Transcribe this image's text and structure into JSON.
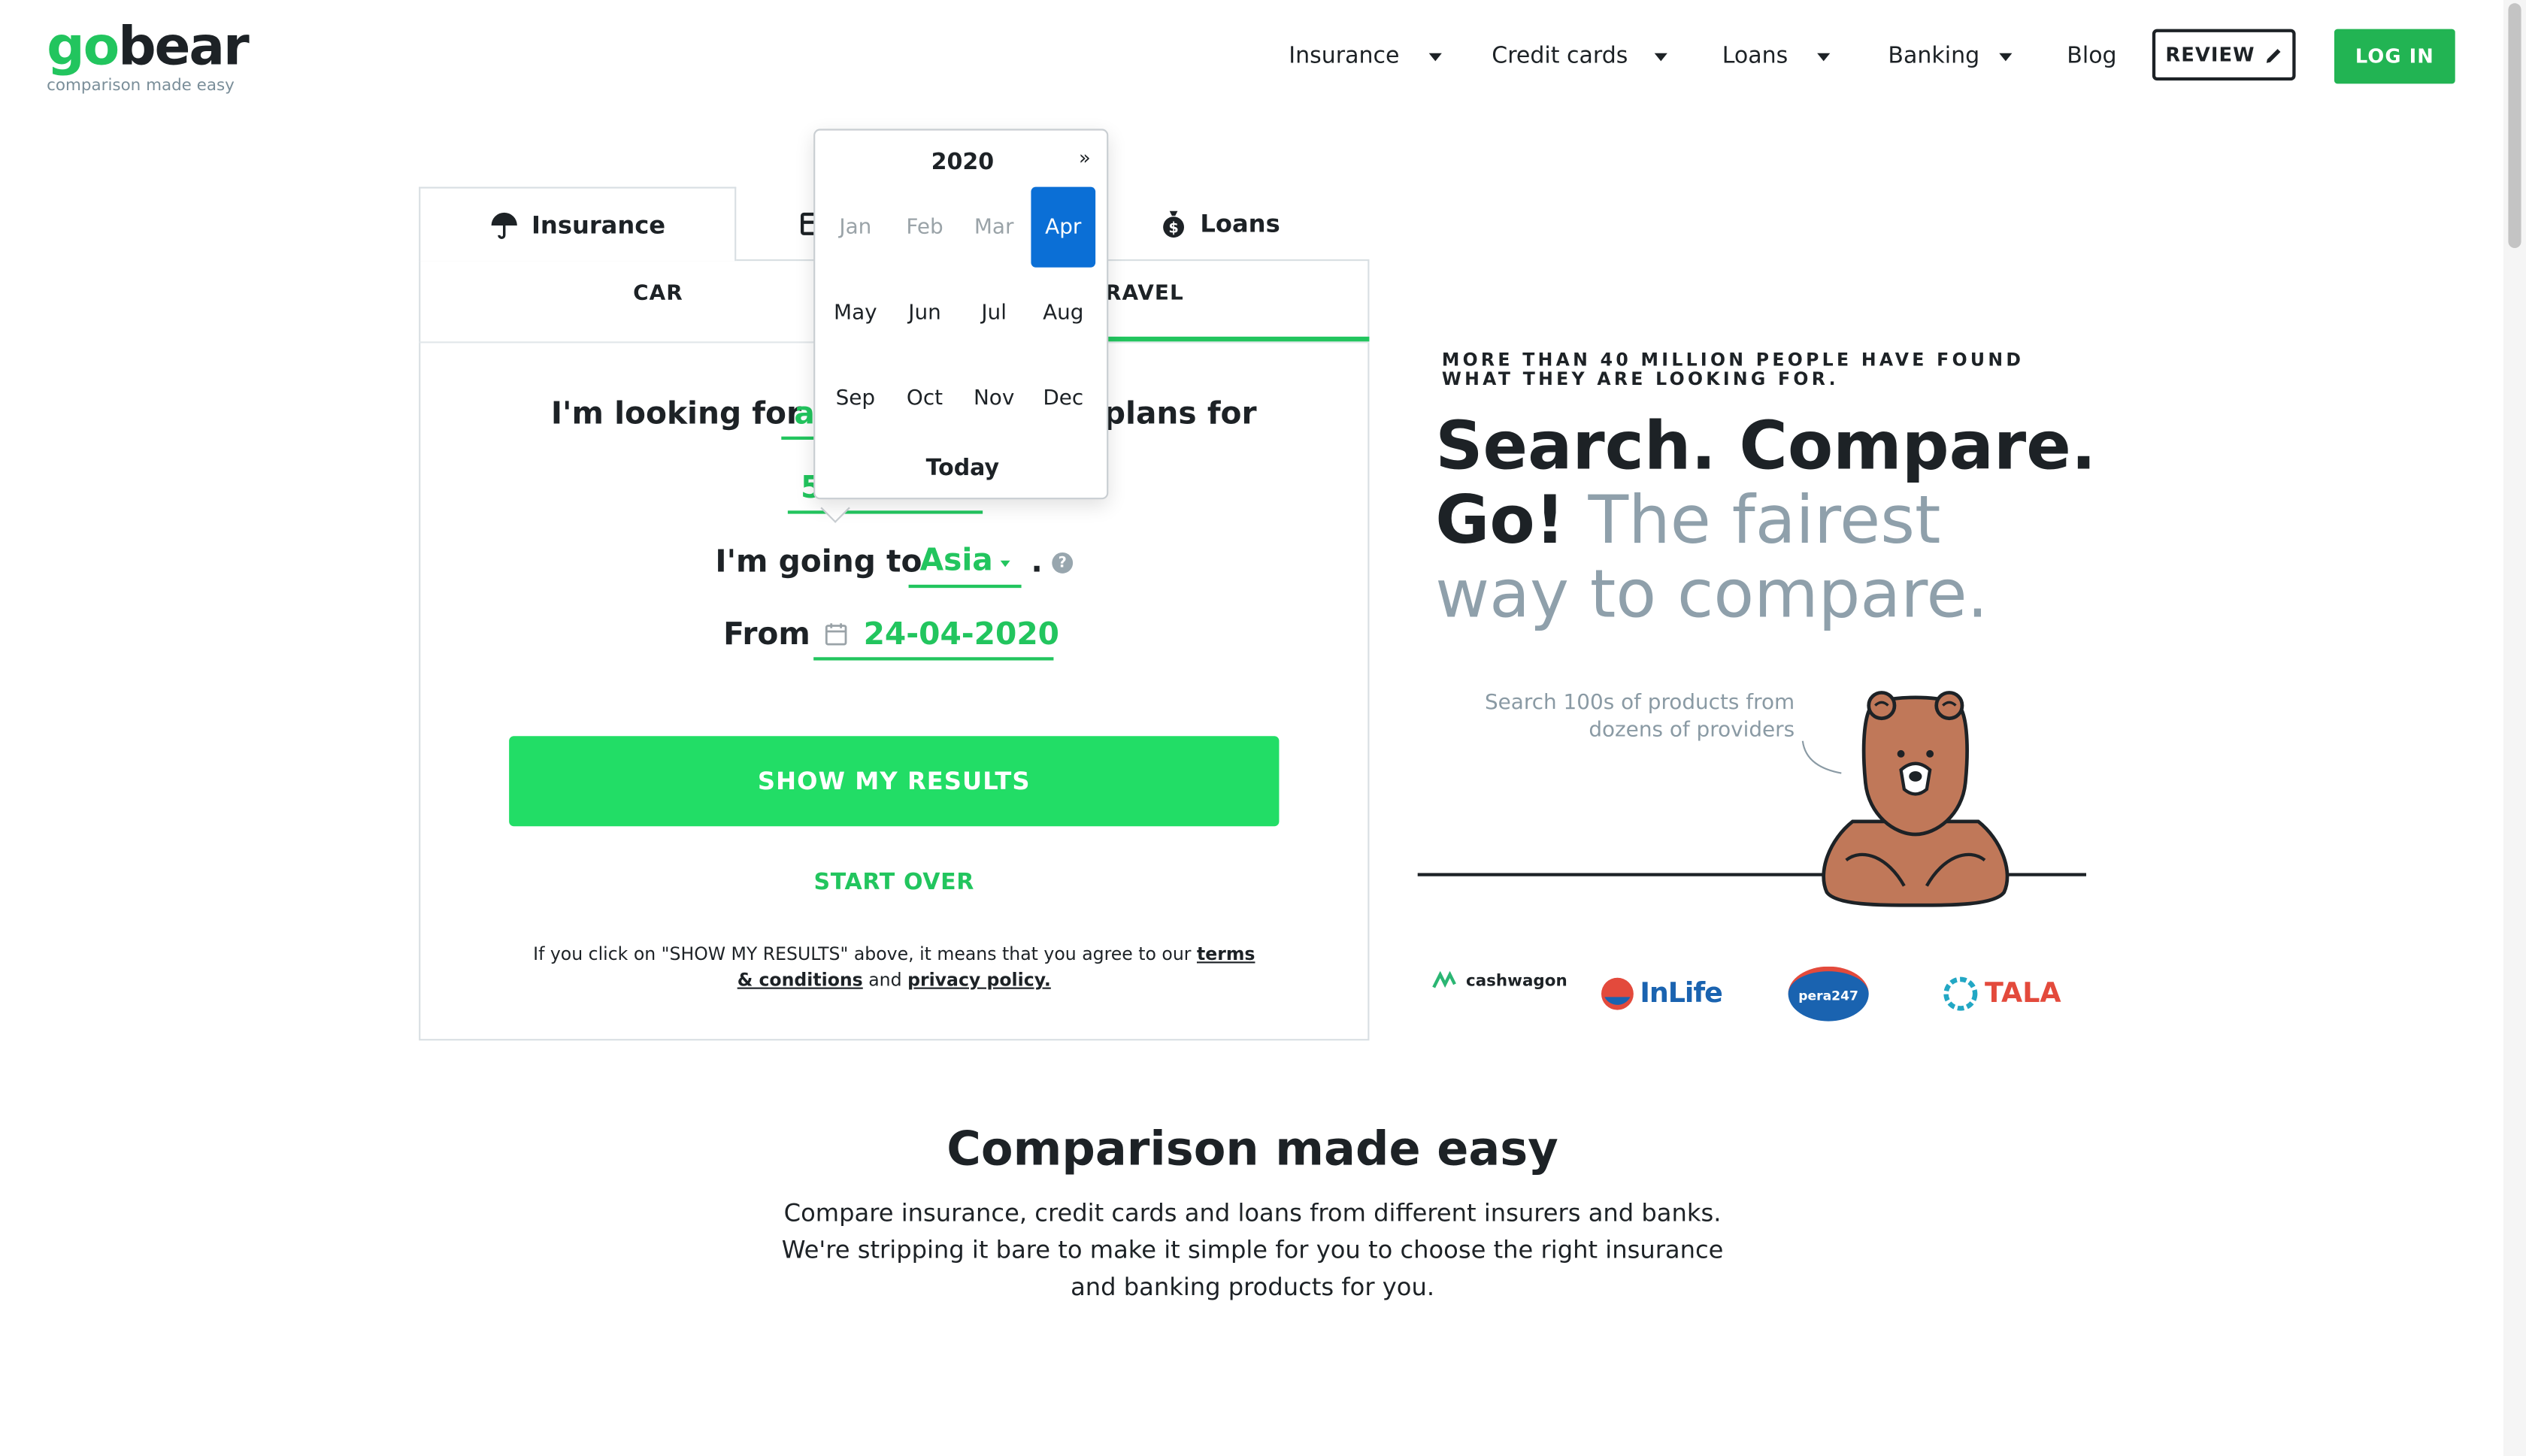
{
  "brand": {
    "logo_prefix": "go",
    "logo_suffix": "bear",
    "tagline": "comparison made easy"
  },
  "nav": {
    "items": [
      {
        "label": "Insurance"
      },
      {
        "label": "Credit cards"
      },
      {
        "label": "Loans"
      },
      {
        "label": "Banking"
      },
      {
        "label": "Blog"
      }
    ],
    "review_label": "REVIEW",
    "login_label": "LOG IN"
  },
  "widget": {
    "tabs": [
      {
        "label": "Insurance"
      },
      {
        "label": ""
      },
      {
        "label": "Loans"
      }
    ],
    "subtabs": [
      {
        "label": "CAR"
      },
      {
        "label": "RAVEL"
      }
    ],
    "q1_prefix": "I'm looking for",
    "q1_value": "a",
    "q1_suffix": "plans for",
    "q1b_value": "5",
    "q2_prefix": "I'm going to",
    "q2_value": "Asia",
    "q2_end": ".",
    "q3_prefix": "From",
    "q3_value": "24-04-2020",
    "show_results": "SHOW MY RESULTS",
    "start_over": "START OVER",
    "disclaimer_text": "If you click on \"SHOW MY RESULTS\" above, it means that you agree to our",
    "terms_link": "terms & conditions",
    "and_text": "and",
    "privacy_link": "privacy policy."
  },
  "calendar": {
    "year": "2020",
    "next": "»",
    "today": "Today",
    "selected_month": "Apr",
    "months": [
      {
        "label": "Jan",
        "state": "disabled"
      },
      {
        "label": "Feb",
        "state": "disabled"
      },
      {
        "label": "Mar",
        "state": "disabled"
      },
      {
        "label": "Apr",
        "state": "active"
      },
      {
        "label": "May",
        "state": "normal"
      },
      {
        "label": "Jun",
        "state": "normal"
      },
      {
        "label": "Jul",
        "state": "normal"
      },
      {
        "label": "Aug",
        "state": "normal"
      },
      {
        "label": "Sep",
        "state": "normal"
      },
      {
        "label": "Oct",
        "state": "normal"
      },
      {
        "label": "Nov",
        "state": "normal"
      },
      {
        "label": "Dec",
        "state": "normal"
      }
    ]
  },
  "hero": {
    "tagline_line1": "MORE THAN 40 MILLION PEOPLE HAVE FOUND",
    "tagline_line2": "WHAT THEY ARE LOOKING FOR.",
    "title_bold_1": "Search. Compare.",
    "title_bold_2": "Go!",
    "title_grey_1": "The fairest",
    "title_grey_2": "way to compare.",
    "callout_1": "Search 100s of products from",
    "callout_2": "dozens of providers"
  },
  "partners": [
    {
      "name": "cashwagon"
    },
    {
      "name": "InLife"
    },
    {
      "name": "pera247"
    },
    {
      "name": "TALA"
    }
  ],
  "bottom": {
    "title": "Comparison made easy",
    "text": "Compare insurance, credit cards and loans from different insurers and banks. We're stripping it bare to make it simple for you to choose the right insurance and banking products for you."
  },
  "colors": {
    "brand_green": "#22c55e",
    "button_green": "#22dd66",
    "calendar_active": "#0b6fd6",
    "text_dark": "#1d2226",
    "text_grey": "#8fa0ab"
  }
}
